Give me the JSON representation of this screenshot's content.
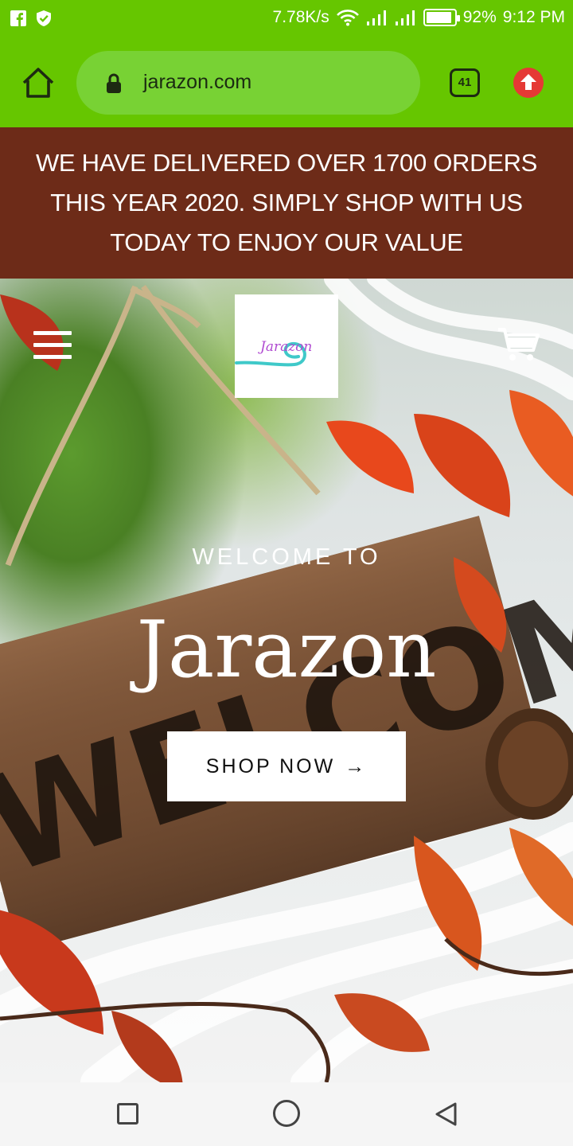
{
  "status_bar": {
    "net_speed": "7.78K/s",
    "battery_level": 0.92,
    "battery_label": "92%",
    "time": "9:12 PM",
    "icons": [
      "facebook-icon",
      "shield-icon",
      "wifi-icon",
      "signal-icon",
      "signal-icon",
      "battery-icon"
    ]
  },
  "browser": {
    "url": "jarazon.com",
    "tab_count": "41",
    "icons": [
      "home-icon",
      "lock-icon",
      "tabs-icon",
      "upload-icon"
    ]
  },
  "announcement": {
    "text": "WE HAVE DELIVERED OVER 1700 ORDERS THIS YEAR 2020. SIMPLY SHOP WITH US TODAY TO ENJOY OUR VALUE"
  },
  "hero": {
    "logo_text": "Jarazon",
    "eyebrow": "WELCOME TO",
    "title": "Jarazon",
    "cta_label": "SHOP NOW",
    "cta_arrow": "→",
    "sign_text": "WELCOME",
    "icons": [
      "menu-icon",
      "cart-icon"
    ]
  },
  "colors": {
    "browser_green": "#66c600",
    "announcement_brown": "#6d2b18",
    "logo_teal": "#3fc9c9",
    "logo_purple": "#b04ad1"
  }
}
